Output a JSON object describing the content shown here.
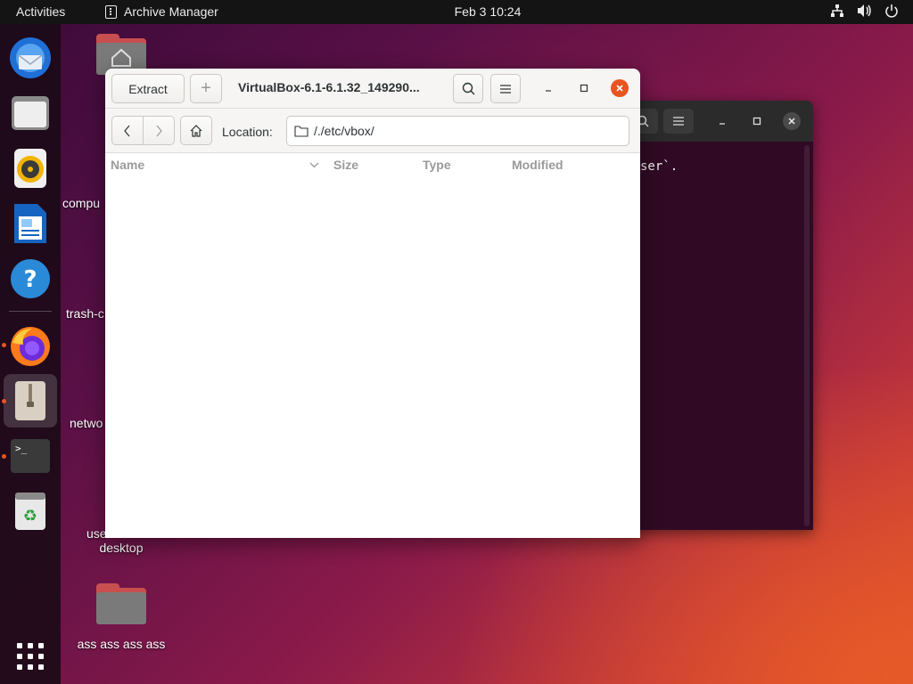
{
  "topbar": {
    "activities": "Activities",
    "app_name": "Archive Manager",
    "clock": "Feb 3  10:24"
  },
  "dock": {
    "items": [
      {
        "name": "thunderbird-icon"
      },
      {
        "name": "files-icon"
      },
      {
        "name": "rhythmbox-icon"
      },
      {
        "name": "libreoffice-writer-icon"
      },
      {
        "name": "help-icon"
      },
      {
        "name": "firefox-icon"
      },
      {
        "name": "archive-manager-icon"
      },
      {
        "name": "terminal-icon"
      },
      {
        "name": "trash-icon"
      },
      {
        "name": "show-applications-icon"
      }
    ]
  },
  "desktop": {
    "icons": [
      {
        "label": ""
      },
      {
        "label": "compu"
      },
      {
        "label": "trash-c"
      },
      {
        "label": "netwo"
      },
      {
        "label_line1": "use",
        "label_line2": "desktop"
      },
      {
        "label": "ass ass ass ass"
      }
    ]
  },
  "terminal": {
    "visible_text": "ser`."
  },
  "archive_window": {
    "extract_label": "Extract",
    "add_label": "+",
    "title": "VirtualBox-6.1-6.1.32_149290...",
    "location_label": "Location:",
    "location_value": "/./etc/vbox/",
    "columns": [
      "Name",
      "Size",
      "Type",
      "Modified"
    ]
  },
  "colors": {
    "accent": "#e95420",
    "topbar": "#141414",
    "headerbar": "#f6f5f4"
  }
}
